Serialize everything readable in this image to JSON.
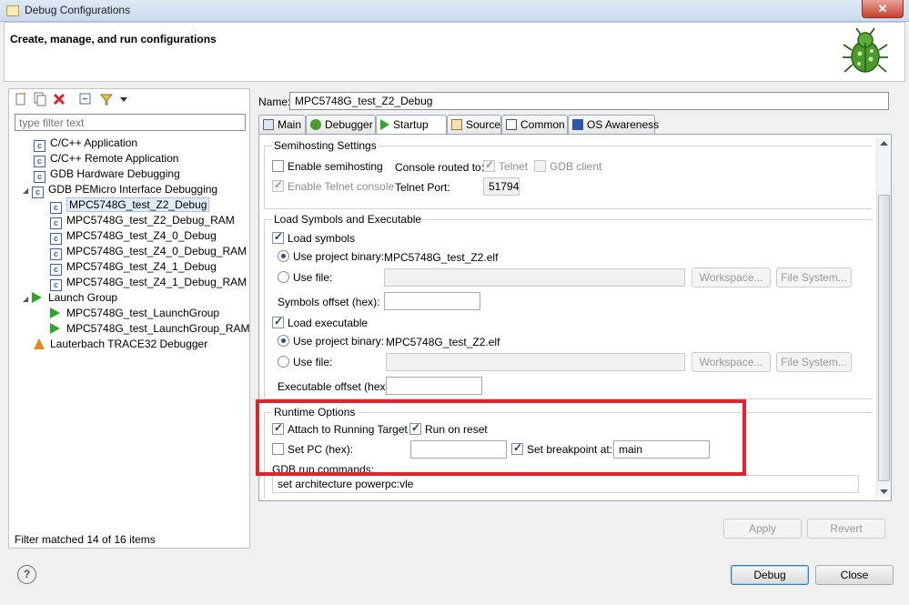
{
  "window": {
    "title": "Debug Configurations",
    "close_label": "✕"
  },
  "header": {
    "title": "Create, manage, and run configurations"
  },
  "left": {
    "filter_placeholder": "type filter text",
    "tree": [
      {
        "label": "C/C++ Application"
      },
      {
        "label": "C/C++ Remote Application"
      },
      {
        "label": "GDB Hardware Debugging"
      },
      {
        "label": "GDB PEMicro Interface Debugging",
        "expander": "◢"
      },
      {
        "label": "MPC5748G_test_Z2_Debug"
      },
      {
        "label": "MPC5748G_test_Z2_Debug_RAM"
      },
      {
        "label": "MPC5748G_test_Z4_0_Debug"
      },
      {
        "label": "MPC5748G_test_Z4_0_Debug_RAM"
      },
      {
        "label": "MPC5748G_test_Z4_1_Debug"
      },
      {
        "label": "MPC5748G_test_Z4_1_Debug_RAM"
      },
      {
        "label": "Launch Group",
        "expander": "◢"
      },
      {
        "label": "MPC5748G_test_LaunchGroup"
      },
      {
        "label": "MPC5748G_test_LaunchGroup_RAM"
      },
      {
        "label": "Lauterbach TRACE32 Debugger"
      }
    ],
    "filter_status": "Filter matched 14 of 16 items"
  },
  "right": {
    "name_label": "Name:",
    "name_value": "MPC5748G_test_Z2_Debug",
    "tabs": [
      "Main",
      "Debugger",
      "Startup",
      "Source",
      "Common",
      "OS Awareness"
    ],
    "semihosting": {
      "title": "Semihosting Settings",
      "enable_semihosting": "Enable semihosting",
      "console_routed": "Console routed to:",
      "telnet": "Telnet",
      "gdb_client": "GDB client",
      "enable_telnet_console": "Enable Telnet console",
      "telnet_port_label": "Telnet Port:",
      "telnet_port_value": "51794"
    },
    "load": {
      "title": "Load Symbols and Executable",
      "load_symbols": "Load symbols",
      "use_project_binary": "Use project binary:",
      "symbols_binary": "MPC5748G_test_Z2.elf",
      "use_file": "Use file:",
      "workspace": "Workspace...",
      "file_system": "File System...",
      "symbols_offset": "Symbols offset (hex):",
      "load_executable": "Load executable",
      "exec_binary": "MPC5748G_test_Z2.elf",
      "exec_offset": "Executable offset (hex):"
    },
    "runtime": {
      "title": "Runtime Options",
      "attach": "Attach to Running Target",
      "run_on_reset": "Run on reset",
      "set_pc": "Set PC (hex):",
      "set_breakpoint": "Set breakpoint at:",
      "breakpoint_value": "main",
      "gdb_run_commands": "GDB run commands:",
      "gdb_command_text": "set architecture powerpc:vle"
    },
    "apply": "Apply",
    "revert": "Revert"
  },
  "footer": {
    "help": "?",
    "debug": "Debug",
    "close": "Close"
  }
}
